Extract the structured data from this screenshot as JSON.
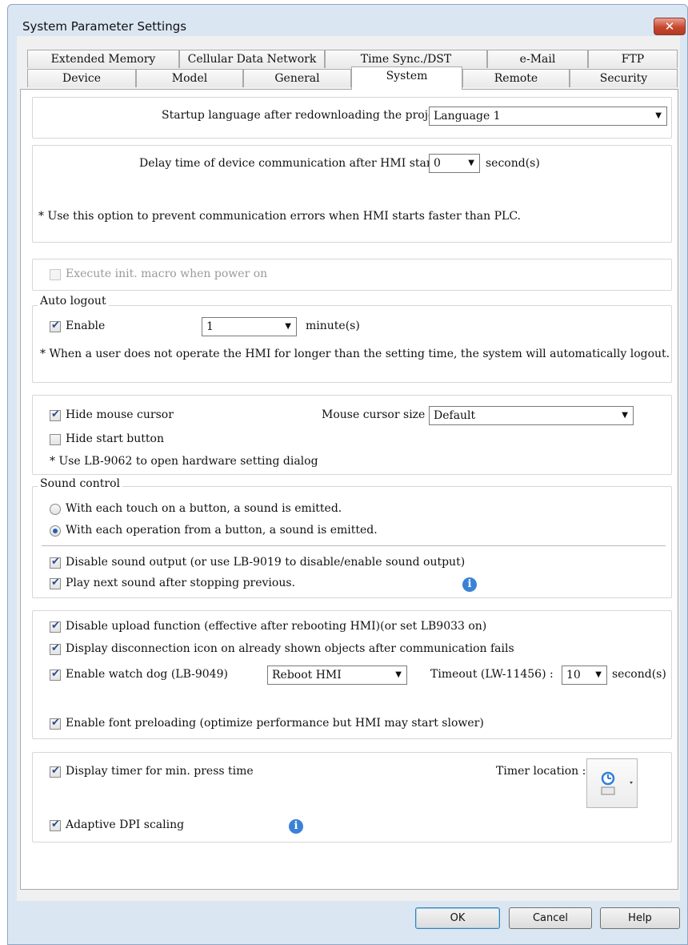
{
  "window": {
    "title": "System Parameter Settings",
    "close_label": "✕"
  },
  "tabs_row1": [
    "Extended Memory",
    "Cellular Data Network",
    "Time Sync./DST",
    "e-Mail",
    "FTP"
  ],
  "tabs_row2": [
    "Device",
    "Model",
    "General",
    "System",
    "Remote",
    "Security"
  ],
  "active_tab": "System",
  "startup": {
    "label": "Startup language after redownloading the project :",
    "value": "Language 1"
  },
  "delay": {
    "label": "Delay time of device communication after HMI starts :",
    "value": "0",
    "unit": "second(s)",
    "note": "* Use this option to prevent communication errors when HMI starts faster than PLC."
  },
  "init_macro": {
    "label": "Execute init. macro when power on",
    "checked": false,
    "enabled": false
  },
  "auto_logout": {
    "legend": "Auto logout",
    "enable_label": "Enable",
    "enable_checked": true,
    "minutes_value": "1",
    "unit": "minute(s)",
    "note": "* When a user does not operate the HMI for longer than the setting time, the system will automatically logout."
  },
  "mouse": {
    "hide_cursor_label": "Hide mouse cursor",
    "hide_cursor_checked": true,
    "size_label": "Mouse cursor size :",
    "size_value": "Default",
    "hide_start_label": "Hide start button",
    "hide_start_checked": false,
    "note": "* Use LB-9062 to open hardware setting dialog"
  },
  "sound": {
    "legend": "Sound control",
    "radio1_label": "With each touch on a button, a sound is emitted.",
    "radio1_selected": false,
    "radio2_label": "With each operation from a button, a sound is emitted.",
    "radio2_selected": true,
    "disable_label": "Disable sound output (or use LB-9019 to disable/enable sound output)",
    "disable_checked": true,
    "playnext_label": "Play next sound after stopping previous.",
    "playnext_checked": true
  },
  "misc": {
    "upload_label": "Disable upload function (effective after rebooting HMI)(or set LB9033 on)",
    "upload_checked": true,
    "disconnect_label": "Display disconnection icon on already shown objects after communication fails",
    "disconnect_checked": true,
    "watchdog_label": "Enable watch dog (LB-9049)",
    "watchdog_checked": true,
    "watchdog_action": "Reboot HMI",
    "timeout_label": "Timeout (LW-11456) :",
    "timeout_value": "10",
    "timeout_unit": "second(s)",
    "font_label": "Enable font preloading (optimize performance but HMI may start slower)",
    "font_checked": true
  },
  "timer": {
    "display_label": "Display timer for min. press time",
    "display_checked": true,
    "location_label": "Timer location :",
    "dpi_label": "Adaptive DPI scaling",
    "dpi_checked": true
  },
  "buttons": {
    "ok": "OK",
    "cancel": "Cancel",
    "help": "Help"
  },
  "colors": {
    "info_icon": "#3b82d6",
    "titlebar": "#dbe6f3",
    "close": "#c8482f"
  }
}
